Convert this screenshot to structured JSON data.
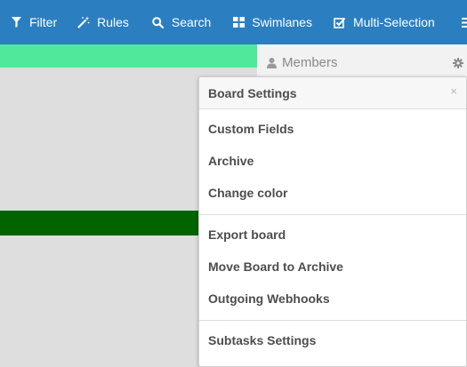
{
  "toolbar": {
    "color": "#2b7fc1",
    "items": [
      {
        "label": "Filter",
        "icon": "filter-icon"
      },
      {
        "label": "Rules",
        "icon": "magic-wand-icon"
      },
      {
        "label": "Search",
        "icon": "search-icon"
      },
      {
        "label": "Swimlanes",
        "icon": "swimlanes-icon"
      },
      {
        "label": "Multi-Selection",
        "icon": "checkbox-icon"
      }
    ],
    "menu_icon": "hamburger-menu-icon"
  },
  "sidebar": {
    "members_label": "Members",
    "members_icon": "person-icon",
    "settings_icon": "gear-icon"
  },
  "board": {
    "top_bar_color": "#50e89a",
    "dark_bar_color": "#006400"
  },
  "popup": {
    "title": "Board Settings",
    "close_label": "×",
    "groups": [
      [
        {
          "label": "Custom Fields"
        },
        {
          "label": "Archive"
        },
        {
          "label": "Change color"
        }
      ],
      [
        {
          "label": "Export board"
        },
        {
          "label": "Move Board to Archive"
        },
        {
          "label": "Outgoing Webhooks"
        }
      ],
      [
        {
          "label": "Subtasks Settings"
        }
      ]
    ]
  }
}
